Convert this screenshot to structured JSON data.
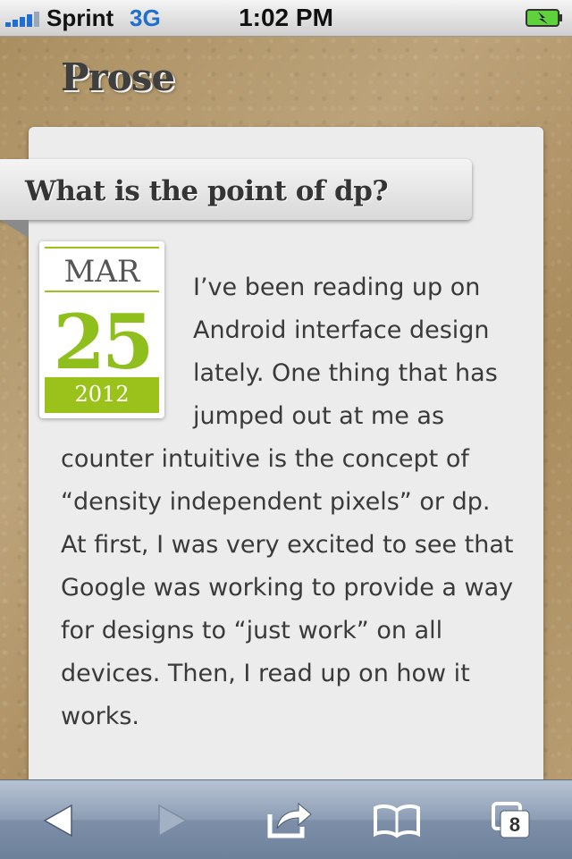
{
  "status_bar": {
    "carrier": "Sprint",
    "network": "3G",
    "time": "1:02 PM"
  },
  "app": {
    "title": "Prose"
  },
  "article": {
    "title": "What is the point of dp?",
    "date": {
      "month": "MAR",
      "day": "25",
      "year": "2012"
    },
    "body": "I’ve been reading up on Android interface design lately. One thing that has jumped out at me as counter intuitive is the concept of “density independent pixels” or dp. At first, I was very excited to see that Google was working to provide a way for designs to “just work” on all devices. Then, I read up on how it works."
  },
  "toolbar": {
    "icons": [
      "back-arrow-icon",
      "forward-arrow-icon",
      "share-icon",
      "bookmarks-icon",
      "tabs-icon"
    ],
    "tabs_count": "8"
  },
  "colors": {
    "accent": "#9bc21b",
    "status_blue": "#1e6fd1",
    "card": "#ececec"
  }
}
